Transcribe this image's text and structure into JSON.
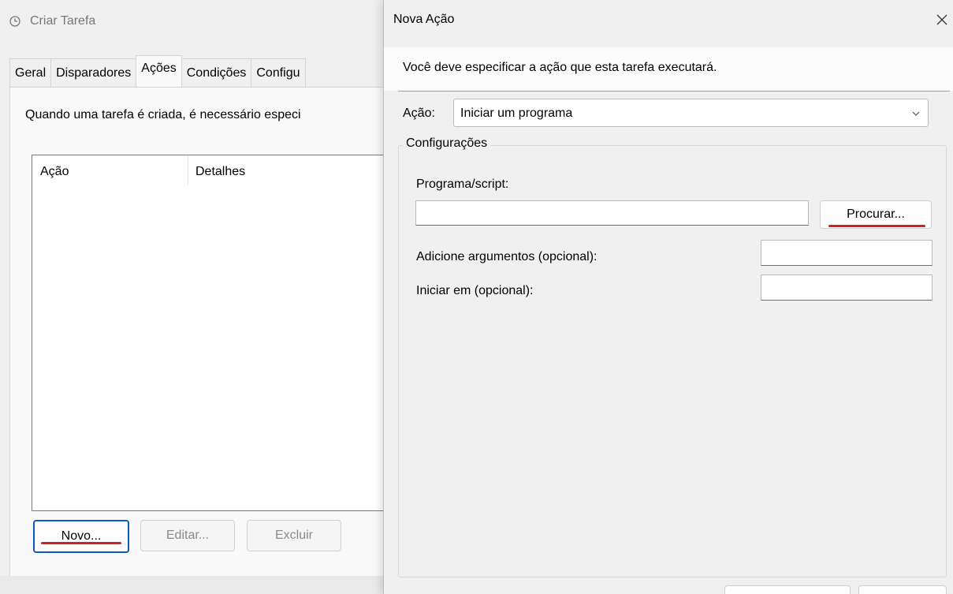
{
  "background_window": {
    "title": "Criar Tarefa",
    "tabs": [
      {
        "label": "Geral"
      },
      {
        "label": "Disparadores"
      },
      {
        "label": "Ações"
      },
      {
        "label": "Condições"
      },
      {
        "label": "Configu"
      }
    ],
    "active_tab": "Ações",
    "description": "Quando uma tarefa é criada, é necessário especi",
    "list_columns": [
      "Ação",
      "Detalhes"
    ],
    "buttons": {
      "novo": "Novo...",
      "editar": "Editar...",
      "excluir": "Excluir"
    }
  },
  "dialog": {
    "title": "Nova Ação",
    "instruction": "Você deve especificar a ação que esta tarefa executará.",
    "action_label": "Ação:",
    "action_value": "Iniciar um programa",
    "group_label": "Configurações",
    "program_label": "Programa/script:",
    "program_value": "",
    "browse_button": "Procurar...",
    "arguments_label": "Adicione argumentos (opcional):",
    "arguments_value": "",
    "start_in_label": "Iniciar em (opcional):",
    "start_in_value": ""
  },
  "icons": {
    "title_icon": "clock-icon",
    "close_icon": "close-icon",
    "dropdown_icon": "chevron-down-icon"
  },
  "colors": {
    "highlight_underline": "#d61f1f",
    "focus_border": "#0b57c6"
  }
}
